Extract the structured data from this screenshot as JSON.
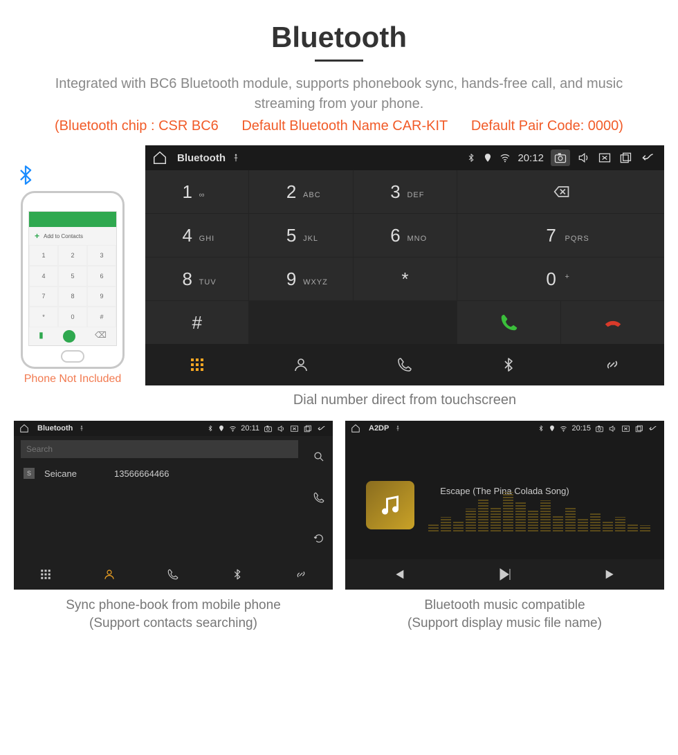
{
  "header": {
    "title": "Bluetooth",
    "subtitle": "Integrated with BC6 Bluetooth module, supports phonebook sync, hands-free call, and music streaming from your phone.",
    "specs": {
      "chip": "(Bluetooth chip : CSR BC6",
      "name": "Default Bluetooth Name CAR-KIT",
      "code": "Default Pair Code: 0000)"
    }
  },
  "phone_mock": {
    "add_contacts": "Add to Contacts",
    "not_included": "Phone Not Included",
    "keys": [
      "1",
      "2",
      "3",
      "4",
      "5",
      "6",
      "7",
      "8",
      "9",
      "*",
      "0",
      "#"
    ]
  },
  "dialer": {
    "status_title": "Bluetooth",
    "time": "20:12",
    "keys": [
      {
        "d": "1",
        "s": "∞"
      },
      {
        "d": "2",
        "s": "ABC"
      },
      {
        "d": "3",
        "s": "DEF"
      },
      {
        "d": "4",
        "s": "GHI"
      },
      {
        "d": "5",
        "s": "JKL"
      },
      {
        "d": "6",
        "s": "MNO"
      },
      {
        "d": "7",
        "s": "PQRS"
      },
      {
        "d": "8",
        "s": "TUV"
      },
      {
        "d": "9",
        "s": "WXYZ"
      },
      {
        "d": "*",
        "s": ""
      },
      {
        "d": "0",
        "s": "+"
      },
      {
        "d": "#",
        "s": ""
      }
    ],
    "caption": "Dial number direct from touchscreen"
  },
  "phonebook": {
    "status_title": "Bluetooth",
    "time": "20:11",
    "search_placeholder": "Search",
    "contact_badge": "S",
    "contact_name": "Seicane",
    "contact_number": "13566664466",
    "caption_l1": "Sync phone-book from mobile phone",
    "caption_l2": "(Support contacts searching)"
  },
  "music": {
    "status_title": "A2DP",
    "time": "20:15",
    "song": "Escape (The Pina Colada Song)",
    "caption_l1": "Bluetooth music compatible",
    "caption_l2": "(Support display music file name)"
  }
}
